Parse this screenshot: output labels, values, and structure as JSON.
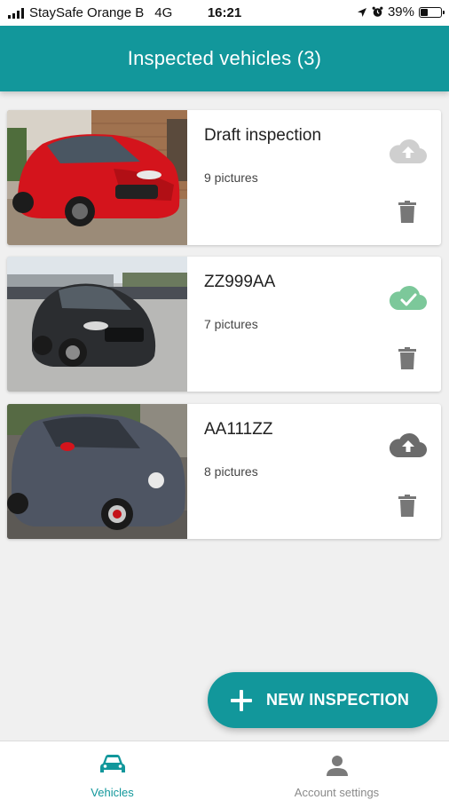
{
  "status_bar": {
    "carrier": "StaySafe Orange B",
    "network": "4G",
    "time": "16:21",
    "battery": "39%",
    "battery_level": 0.39
  },
  "header": {
    "title": "Inspected vehicles (3)"
  },
  "vehicles": [
    {
      "title": "Draft inspection",
      "pictures": "9 pictures",
      "upload_icon": "cloud-upload-icon",
      "upload_state": "disabled",
      "car_color": "#d4141c"
    },
    {
      "title": "ZZ999AA",
      "pictures": "7 pictures",
      "upload_icon": "cloud-done-icon",
      "upload_state": "done",
      "car_color": "#2b2d30"
    },
    {
      "title": "AA111ZZ",
      "pictures": "8 pictures",
      "upload_icon": "cloud-upload-icon",
      "upload_state": "pending",
      "car_color": "#4e5563"
    }
  ],
  "fab": {
    "label": "NEW INSPECTION",
    "icon": "plus-icon"
  },
  "bottom_nav": {
    "items": [
      {
        "label": "Vehicles",
        "icon": "car-icon",
        "active": true
      },
      {
        "label": "Account settings",
        "icon": "person-icon",
        "active": false
      }
    ]
  },
  "colors": {
    "primary": "#12979b",
    "upload_disabled": "#cfcfcf",
    "upload_done": "#7cc89a",
    "upload_pending": "#6b6b6b",
    "icon_gray": "#777777"
  }
}
